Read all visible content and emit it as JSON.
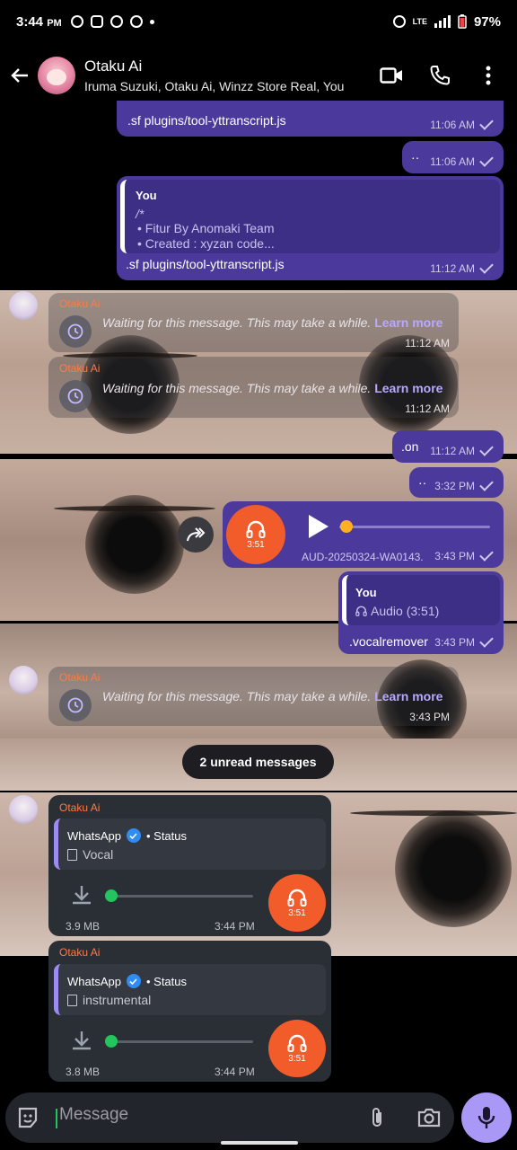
{
  "status_bar": {
    "time": "3:44",
    "time_suffix": "PM",
    "battery": "97%",
    "network": "LTE"
  },
  "header": {
    "title": "Otaku Ai",
    "subtitle": "Iruma Suzuki, Otaku Ai, Winzz Store Real, You"
  },
  "messages": {
    "m1": {
      "text": ".sf plugins/tool-yttranscript.js",
      "time": "11:06 AM"
    },
    "m2": {
      "text": "··",
      "time": "11:06 AM"
    },
    "m3": {
      "quote_name": "You",
      "quote_lines": [
        "/*",
        "• Fitur By Anomaki Team",
        "• Created : xyzan code..."
      ],
      "text": ".sf plugins/tool-yttranscript.js",
      "time": "11:12 AM"
    },
    "w1": {
      "sender": "Otaku Ai",
      "text": "Waiting for this message. This may take a while.",
      "link": "Learn more",
      "time": "11:12 AM"
    },
    "w2": {
      "sender": "Otaku Ai",
      "text": "Waiting for this message. This may take a while.",
      "link": "Learn more",
      "time": "11:12 AM"
    },
    "m4": {
      "text": ".on",
      "time": "11:12 AM"
    },
    "m5": {
      "text": "··",
      "time": "3:32 PM"
    },
    "audio": {
      "duration": "3:51",
      "file": "AUD-20250324-WA0143.",
      "time": "3:43 PM",
      "progress": 0
    },
    "m6": {
      "quote_name": "You",
      "quote_line": "Audio (3:51)",
      "text": ".vocalremover",
      "time": "3:43 PM"
    },
    "w3": {
      "sender": "Otaku Ai",
      "text": "Waiting for this message. This may take a while.",
      "link": "Learn more",
      "time": "3:43 PM"
    }
  },
  "unread": "2 unread messages",
  "status_msgs": [
    {
      "sender": "Otaku Ai",
      "source": "WhatsApp",
      "status_label": "• Status",
      "doc": "Vocal",
      "size": "3.9 MB",
      "time": "3:44 PM",
      "duration": "3:51"
    },
    {
      "sender": "Otaku Ai",
      "source": "WhatsApp",
      "status_label": "• Status",
      "doc": "instrumental",
      "size": "3.8 MB",
      "time": "3:44 PM",
      "duration": "3:51"
    }
  ],
  "composer": {
    "placeholder": "Message"
  },
  "colors": {
    "accent": "#4b3a9c",
    "sender": "#ff7a45",
    "link": "#b9a8ff",
    "audio": "#f25b2a",
    "mic": "#a998f5"
  }
}
